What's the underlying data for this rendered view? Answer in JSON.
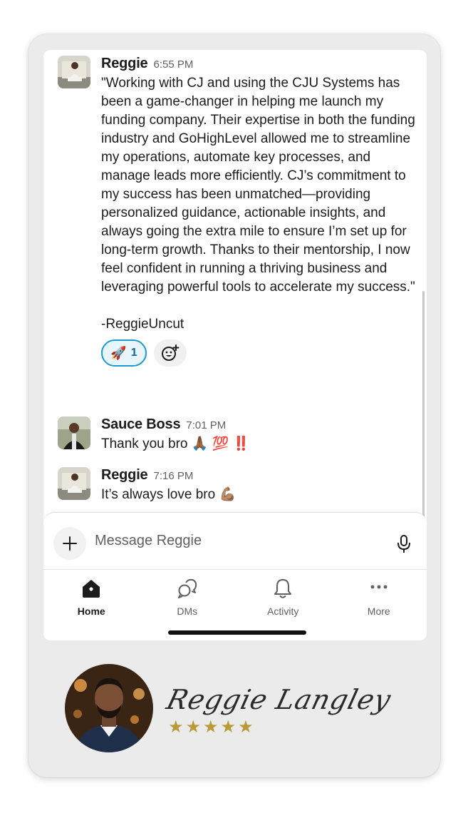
{
  "messages": [
    {
      "author": "Reggie",
      "time": "6:55 PM",
      "text": "\"Working with CJ and using the CJU Systems has been a game-changer in helping me launch my funding company. Their expertise in both the funding industry and GoHighLevel allowed me to streamline my operations, automate key processes, and manage leads more efficiently. CJ’s commitment to my success has been unmatched—providing personalized guidance, actionable insights, and always going the extra mile to ensure I’m set up for long-term growth. Thanks to their mentorship, I now feel confident in running a thriving business and leveraging powerful tools to accelerate my success.\"\n\n-ReggieUncut",
      "reaction": {
        "emoji": "🚀",
        "count": "1"
      }
    },
    {
      "author": "Sauce Boss",
      "time": "7:01 PM",
      "text": "Thank you bro 🙏🏾 💯 ‼️"
    },
    {
      "author": "Reggie",
      "time": "7:16 PM",
      "text": "It’s always love bro 💪🏽"
    }
  ],
  "composer": {
    "placeholder": "Message Reggie"
  },
  "tabs": [
    {
      "label": "Home",
      "icon": "home-icon",
      "active": true
    },
    {
      "label": "DMs",
      "icon": "dms-icon",
      "active": false
    },
    {
      "label": "Activity",
      "icon": "bell-icon",
      "active": false
    },
    {
      "label": "More",
      "icon": "more-icon",
      "active": false
    }
  ],
  "testimonial": {
    "signature": "Reggie Langley",
    "rating": 5
  },
  "colors": {
    "reaction_border": "#1d9bd1",
    "reaction_bg": "#e8f5fa",
    "star": "#b99a3a",
    "card_bg": "#ebebeb"
  }
}
